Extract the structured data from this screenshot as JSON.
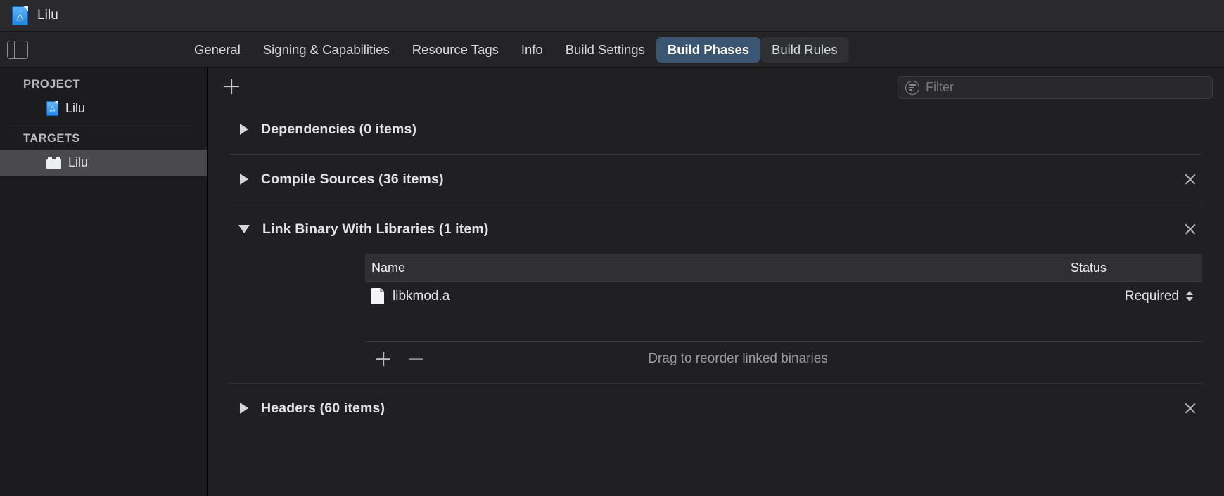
{
  "window": {
    "title": "Lilu",
    "doc_icon": "xcode-project-icon"
  },
  "tabbar": {
    "sidebar_toggle_icon": "sidebar-toggle-icon",
    "tabs": [
      {
        "label": "General",
        "selected": false,
        "hover": false
      },
      {
        "label": "Signing & Capabilities",
        "selected": false,
        "hover": false
      },
      {
        "label": "Resource Tags",
        "selected": false,
        "hover": false
      },
      {
        "label": "Info",
        "selected": false,
        "hover": false
      },
      {
        "label": "Build Settings",
        "selected": false,
        "hover": false
      },
      {
        "label": "Build Phases",
        "selected": true,
        "hover": false
      },
      {
        "label": "Build Rules",
        "selected": false,
        "hover": true
      }
    ],
    "selected_tab_color": "#3b5673"
  },
  "sidebar": {
    "project_header": "PROJECT",
    "project_items": [
      {
        "label": "Lilu",
        "icon": "xcode-project-icon"
      }
    ],
    "targets_header": "TARGETS",
    "target_items": [
      {
        "label": "Lilu",
        "icon": "target-bundle-icon",
        "selected": true
      }
    ],
    "selection_color": "#4a4a4c"
  },
  "toolbar": {
    "add_phase_icon": "plus-icon",
    "filter_icon": "filter-lines-icon",
    "filter_placeholder": "Filter",
    "filter_value": ""
  },
  "phases": [
    {
      "title": "Dependencies (0 items)",
      "expanded": false,
      "closable": false
    },
    {
      "title": "Compile Sources (36 items)",
      "expanded": false,
      "closable": true
    },
    {
      "title": "Link Binary With Libraries (1 item)",
      "expanded": true,
      "closable": true,
      "table": {
        "columns": [
          "Name",
          "Status"
        ],
        "rows": [
          {
            "name": "libkmod.a",
            "icon": "file-icon",
            "status": "Required",
            "status_control": "stepper-icon"
          }
        ]
      },
      "footer": {
        "add_icon": "plus-icon",
        "remove_icon": "minus-icon",
        "hint": "Drag to reorder linked binaries"
      }
    },
    {
      "title": "Headers (60 items)",
      "expanded": false,
      "closable": true
    }
  ]
}
